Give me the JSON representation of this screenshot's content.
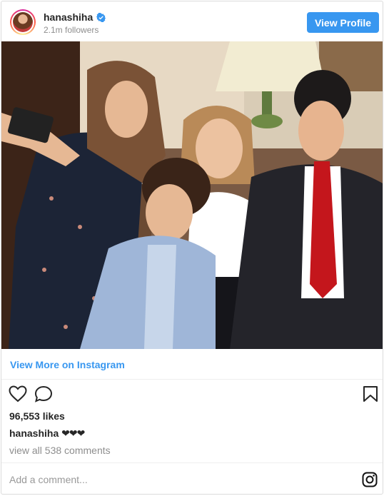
{
  "header": {
    "username": "hanashiha",
    "followers": "2.1m followers",
    "view_profile_label": "View Profile",
    "verified_icon": "verified-badge-icon"
  },
  "photo": {
    "subject": "family-selfie-photo"
  },
  "view_more_label": "View More on Instagram",
  "actions": {
    "icons": [
      "heart-icon",
      "comment-icon",
      "bookmark-icon"
    ]
  },
  "likes": "96,553 likes",
  "caption": {
    "username": "hanashiha",
    "text": "❤❤❤"
  },
  "comments_link": "view all 538 comments",
  "comment_placeholder": "Add a comment...",
  "colors": {
    "accent": "#3897f0",
    "text": "#262626",
    "muted": "#8e8e8e",
    "border": "#dbdbdb"
  }
}
